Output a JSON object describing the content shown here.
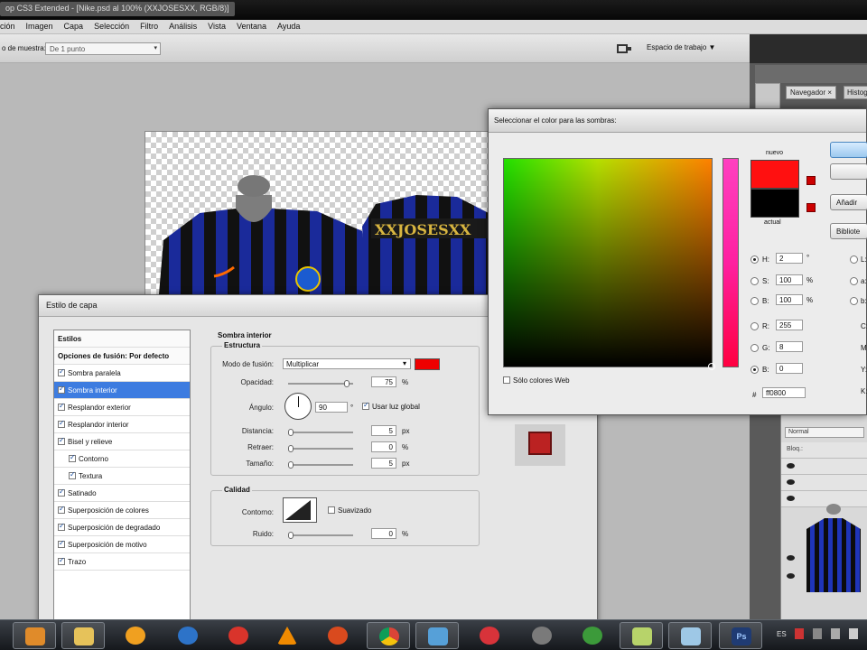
{
  "app": {
    "title": "op CS3 Extended - [Nike.psd al 100% (XXJOSESXX, RGB/8)]"
  },
  "menu": [
    "ción",
    "Imagen",
    "Capa",
    "Selección",
    "Filtro",
    "Análisis",
    "Vista",
    "Ventana",
    "Ayuda"
  ],
  "options": {
    "sample_label": "o de muestra:",
    "sample_value": "De 1 punto",
    "workspace_label": "Espacio de trabajo ▼"
  },
  "panels": {
    "navigator_tab": "Navegador ×",
    "histogram_tab": "Histogr",
    "blend_mode": "Normal",
    "fill_label": "Bloq.:"
  },
  "layer_style": {
    "title": "Estilo de capa",
    "items": [
      {
        "label": "Estilos",
        "type": "head"
      },
      {
        "label": "Opciones de fusión: Por defecto",
        "type": "head"
      },
      {
        "label": "Sombra paralela",
        "checked": true
      },
      {
        "label": "Sombra interior",
        "checked": true,
        "selected": true
      },
      {
        "label": "Resplandor exterior",
        "checked": true
      },
      {
        "label": "Resplandor interior",
        "checked": true
      },
      {
        "label": "Bisel y relieve",
        "checked": true
      },
      {
        "label": "Contorno",
        "checked": true,
        "indent": true
      },
      {
        "label": "Textura",
        "checked": true,
        "indent": true
      },
      {
        "label": "Satinado",
        "checked": true
      },
      {
        "label": "Superposición de colores",
        "checked": true
      },
      {
        "label": "Superposición de degradado",
        "checked": true
      },
      {
        "label": "Superposición de motivo",
        "checked": true
      },
      {
        "label": "Trazo",
        "checked": true
      }
    ],
    "section_title": "Sombra interior",
    "structure_title": "Estructura",
    "blend_mode_label": "Modo de fusión:",
    "blend_mode_value": "Multiplicar",
    "shadow_color": "#e00000",
    "opacity_label": "Opacidad:",
    "opacity_value": "75",
    "angle_label": "Ángulo:",
    "angle_value": "90",
    "global_light_label": "Usar luz global",
    "distance_label": "Distancia:",
    "distance_value": "5",
    "choke_label": "Retraer:",
    "choke_value": "0",
    "size_label": "Tamaño:",
    "size_value": "5",
    "quality_title": "Calidad",
    "contour_label": "Contorno:",
    "antialias_label": "Suavizado",
    "noise_label": "Ruido:",
    "noise_value": "0",
    "units": {
      "px": "px",
      "pct": "%",
      "deg": "°"
    }
  },
  "color_picker": {
    "title": "Seleccionar el color para las sombras:",
    "new_label": "nuevo",
    "current_label": "actual",
    "new_color": "#ff1010",
    "current_color": "#000000",
    "web_only_label": "Sólo colores Web",
    "h_label": "H:",
    "h_value": "2",
    "h_unit": "°",
    "s_label": "S:",
    "s_value": "100",
    "s_unit": "%",
    "b_label": "B:",
    "b_value": "100",
    "b_unit": "%",
    "r_label": "R:",
    "r_value": "255",
    "g_label": "G:",
    "g_value": "8",
    "bb_label": "B:",
    "bb_value": "0",
    "hex_label": "#",
    "hex_value": "ff0800",
    "buttons": [
      "",
      "",
      "Añadir",
      "Bibliote"
    ],
    "right_labels": [
      "L:",
      "a:",
      "b:",
      "C:",
      "M:",
      "Y:",
      "K:"
    ]
  },
  "taskbar": {
    "lang": "ES"
  }
}
